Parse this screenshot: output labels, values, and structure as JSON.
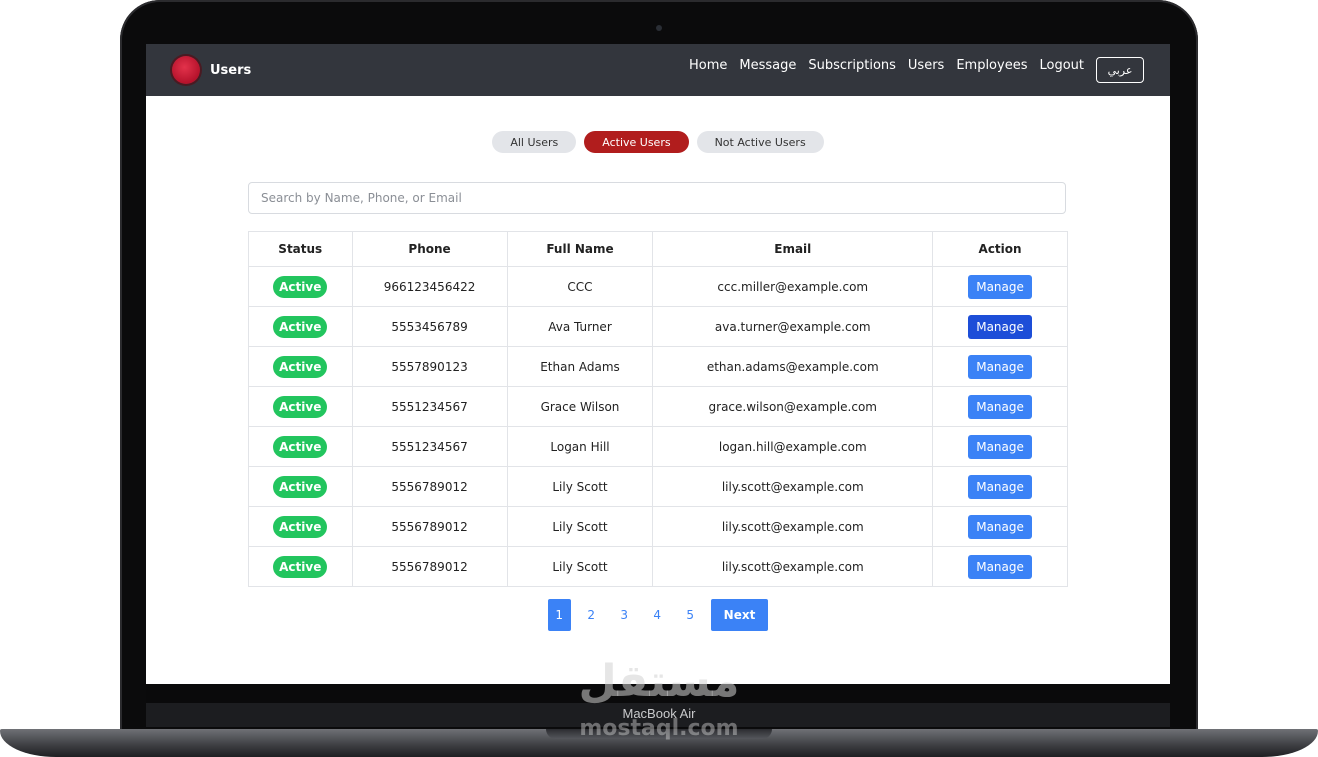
{
  "app": {
    "title": "Users",
    "brand_color": "#b5122b",
    "nav": {
      "links": [
        "Home",
        "Message",
        "Subscriptions",
        "Users",
        "Employees",
        "Logout"
      ],
      "language_button": "عربي"
    }
  },
  "filters": {
    "tabs": [
      "All Users",
      "Active Users",
      "Not Active Users"
    ],
    "selected": "Active Users",
    "accent_color": "#b11d1d"
  },
  "search": {
    "placeholder": "Search by Name, Phone, or Email",
    "value": ""
  },
  "table": {
    "headers": {
      "status": "Status",
      "phone": "Phone",
      "name": "Full Name",
      "email": "Email",
      "action": "Action"
    },
    "rows": [
      {
        "status": "Active",
        "phone": "966123456422",
        "name": "CCC",
        "email": "ccc.miller@example.com",
        "action": "Manage"
      },
      {
        "status": "Active",
        "phone": "5553456789",
        "name": "Ava Turner",
        "email": "ava.turner@example.com",
        "action": "Manage"
      },
      {
        "status": "Active",
        "phone": "5557890123",
        "name": "Ethan Adams",
        "email": "ethan.adams@example.com",
        "action": "Manage"
      },
      {
        "status": "Active",
        "phone": "5551234567",
        "name": "Grace Wilson",
        "email": "grace.wilson@example.com",
        "action": "Manage"
      },
      {
        "status": "Active",
        "phone": "5551234567",
        "name": "Logan Hill",
        "email": "logan.hill@example.com",
        "action": "Manage"
      },
      {
        "status": "Active",
        "phone": "5556789012",
        "name": "Lily Scott",
        "email": "lily.scott@example.com",
        "action": "Manage"
      },
      {
        "status": "Active",
        "phone": "5556789012",
        "name": "Lily Scott",
        "email": "lily.scott@example.com",
        "action": "Manage"
      },
      {
        "status": "Active",
        "phone": "5556789012",
        "name": "Lily Scott",
        "email": "lily.scott@example.com",
        "action": "Manage"
      }
    ],
    "status_color": "#22c55e",
    "button_color": "#3b82f6"
  },
  "pagination": {
    "pages": [
      "1",
      "2",
      "3",
      "4",
      "5"
    ],
    "current": "1",
    "next_label": "Next"
  },
  "device": {
    "model_label": "MacBook Air",
    "watermark_ar": "مستقل",
    "watermark_en": "mostaql.com"
  }
}
